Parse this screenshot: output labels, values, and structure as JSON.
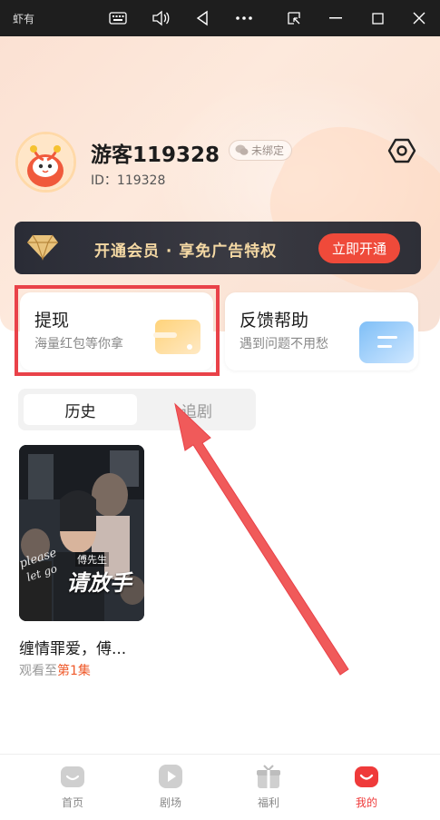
{
  "window": {
    "title": "虾有"
  },
  "profile": {
    "username": "游客119328",
    "bind_status": "未绑定",
    "user_id": "ID：119328"
  },
  "vip": {
    "text": "开通会员 · 享免广告特权",
    "button": "立即开通"
  },
  "cards": [
    {
      "title": "提现",
      "subtitle": "海量红包等你拿"
    },
    {
      "title": "反馈帮助",
      "subtitle": "遇到问题不用愁"
    }
  ],
  "tabs": [
    {
      "label": "历史",
      "active": true
    },
    {
      "label": "追剧",
      "active": false
    }
  ],
  "history": [
    {
      "title": "缠情罪爱，傅...",
      "progress_prefix": "观看至",
      "progress_episode": "第1集",
      "poster_caption": "傅先生",
      "poster_title": "请放手"
    }
  ],
  "bottom_nav": [
    {
      "label": "首页",
      "icon": "home-icon",
      "active": false
    },
    {
      "label": "剧场",
      "icon": "play-icon",
      "active": false
    },
    {
      "label": "福利",
      "icon": "gift-icon",
      "active": false
    },
    {
      "label": "我的",
      "icon": "profile-icon",
      "active": true
    }
  ],
  "colors": {
    "accent": "#ef4a3a",
    "highlight_box": "#e94249",
    "vip_gold": "#f5d9a4",
    "episode": "#ef5a2b"
  }
}
